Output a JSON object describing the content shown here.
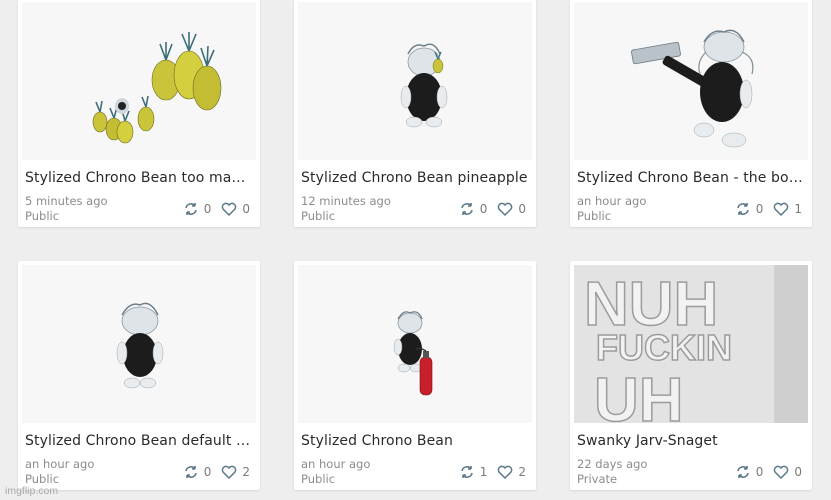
{
  "cards": [
    {
      "title": "Stylized Chrono Bean too many ...",
      "time": "5 minutes ago",
      "visibility": "Public",
      "remixes": "0",
      "likes": "0",
      "thumbnail": "pineapples-scene"
    },
    {
      "title": "Stylized Chrono Bean pineapple",
      "time": "12 minutes ago",
      "visibility": "Public",
      "remixes": "0",
      "likes": "0",
      "thumbnail": "bean-holding-pineapple"
    },
    {
      "title": "Stylized Chrono Bean - the bonk",
      "time": "an hour ago",
      "visibility": "Public",
      "remixes": "0",
      "likes": "1",
      "thumbnail": "bean-with-hammer"
    },
    {
      "title": "Stylized Chrono Bean default p...",
      "time": "an hour ago",
      "visibility": "Public",
      "remixes": "0",
      "likes": "2",
      "thumbnail": "bean-default-pose"
    },
    {
      "title": "Stylized Chrono Bean",
      "time": "an hour ago",
      "visibility": "Public",
      "remixes": "1",
      "likes": "2",
      "thumbnail": "bean-with-extinguisher"
    },
    {
      "title": "Swanky Jarv-Snaget",
      "time": "22 days ago",
      "visibility": "Private",
      "remixes": "0",
      "likes": "0",
      "thumbnail": "3d-block-text",
      "thumbnail_text": [
        "NUH",
        "FUCKIN",
        "UH"
      ]
    }
  ],
  "icons": {
    "remix": "remix-icon",
    "like": "heart-icon"
  },
  "watermark": "imgflip.com",
  "colors": {
    "background": "#eeeeee",
    "card": "#ffffff",
    "title_text": "#2a2a2a",
    "meta_text": "#8c8c8c",
    "pineapple_yellow": "#c9c43a",
    "extinguisher_red": "#c8202a"
  }
}
